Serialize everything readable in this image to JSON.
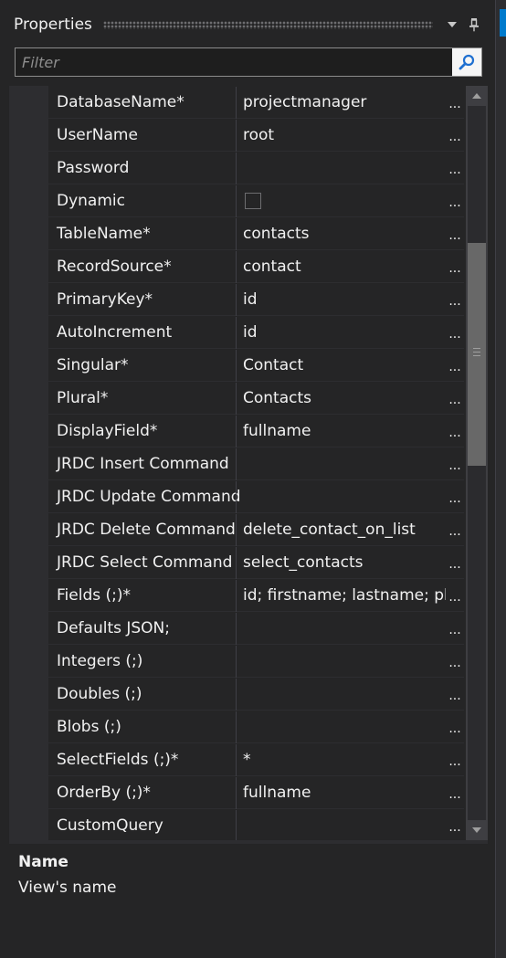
{
  "window": {
    "title": "Properties",
    "dropdown_icon": "chevron-down-icon",
    "pin_icon": "pin-icon"
  },
  "filter": {
    "placeholder": "Filter",
    "value": "",
    "icon": "search-icon"
  },
  "properties": [
    {
      "name": "DatabaseName*",
      "value": "projectmanager"
    },
    {
      "name": "UserName",
      "value": "root"
    },
    {
      "name": "Password",
      "value": ""
    },
    {
      "name": "Dynamic",
      "value": "",
      "checkbox": true,
      "checked": false
    },
    {
      "name": "TableName*",
      "value": "contacts"
    },
    {
      "name": "RecordSource*",
      "value": "contact"
    },
    {
      "name": "PrimaryKey*",
      "value": "id"
    },
    {
      "name": "AutoIncrement",
      "value": "id"
    },
    {
      "name": "Singular*",
      "value": "Contact"
    },
    {
      "name": "Plural*",
      "value": "Contacts"
    },
    {
      "name": "DisplayField*",
      "value": "fullname"
    },
    {
      "name": "JRDC Insert Command",
      "value": ""
    },
    {
      "name": "JRDC Update Command",
      "value": ""
    },
    {
      "name": "JRDC Delete Command",
      "value": "delete_contact_on_list"
    },
    {
      "name": "JRDC Select Command",
      "value": "select_contacts"
    },
    {
      "name": "Fields (;)*",
      "value": "id; firstname; lastname; pho"
    },
    {
      "name": "Defaults JSON;",
      "value": ""
    },
    {
      "name": "Integers (;)",
      "value": ""
    },
    {
      "name": "Doubles (;)",
      "value": ""
    },
    {
      "name": "Blobs (;)",
      "value": ""
    },
    {
      "name": "SelectFields (;)*",
      "value": "*"
    },
    {
      "name": "OrderBy (;)*",
      "value": "fullname"
    },
    {
      "name": "CustomQuery",
      "value": ""
    }
  ],
  "ellipsis_label": "...",
  "description": {
    "title": "Name",
    "text": "View's name"
  },
  "colors": {
    "panel_background": "#252526",
    "chrome": "#2d2d30",
    "accent": "#007acc",
    "text": "#f1f1f1"
  }
}
